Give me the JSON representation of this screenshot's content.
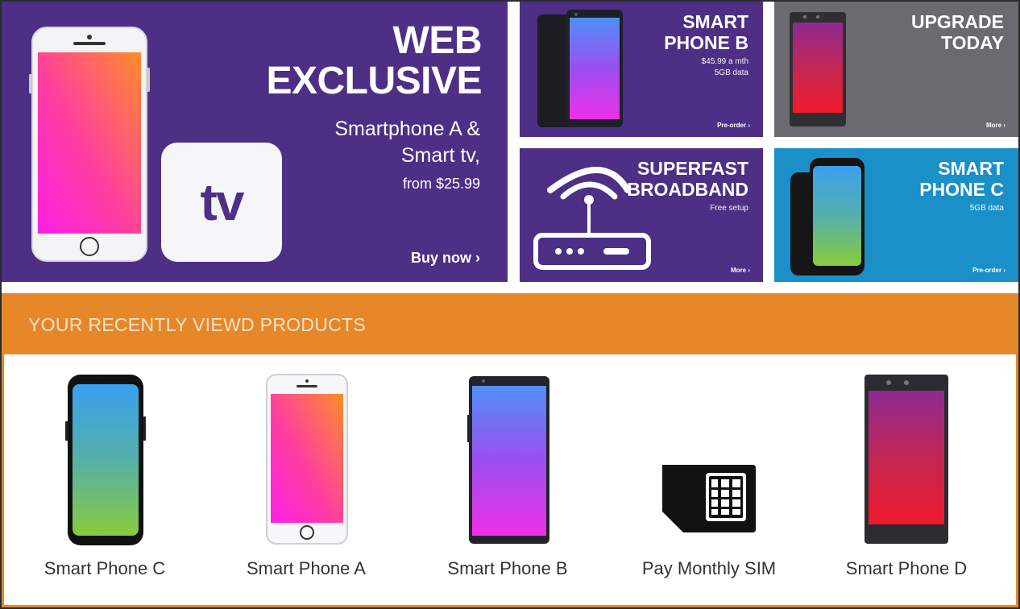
{
  "hero": {
    "title_line1": "WEB",
    "title_line2": "EXCLUSIVE",
    "subtitle_line1": "Smartphone A &",
    "subtitle_line2": "Smart tv,",
    "price": "from $25.99",
    "cta": "Buy now ›",
    "tv_label": "tv"
  },
  "tiles": {
    "phone_b": {
      "title_line1": "SMART",
      "title_line2": "PHONE B",
      "line1": "$45.99 a mth",
      "line2": "5GB data",
      "cta": "Pre-order ›"
    },
    "upgrade": {
      "title_line1": "UPGRADE",
      "title_line2": "TODAY",
      "cta": "More ›"
    },
    "broadband": {
      "title_line1": "SUPERFAST",
      "title_line2": "BROADBAND",
      "line1": "Free setup",
      "cta": "More ›"
    },
    "phone_c": {
      "title_line1": "SMART",
      "title_line2": "PHONE C",
      "line1": "5GB data",
      "cta": "Pre-order ›"
    }
  },
  "recent": {
    "header": "YOUR RECENTLY VIEWD PRODUCTS",
    "items": [
      {
        "label": "Smart Phone C"
      },
      {
        "label": "Smart Phone A"
      },
      {
        "label": "Smart Phone B"
      },
      {
        "label": "Pay Monthly SIM"
      },
      {
        "label": "Smart Phone D"
      }
    ]
  },
  "colors": {
    "purple": "#4d2f86",
    "grey": "#6b6b6f",
    "blue": "#1b8fc7",
    "orange": "#e6882a"
  },
  "icons": [
    "smartphone-a-icon",
    "tv-icon",
    "smartphone-b-icon",
    "smartphone-d-icon",
    "router-icon",
    "smartphone-c-icon",
    "sim-card-icon"
  ]
}
